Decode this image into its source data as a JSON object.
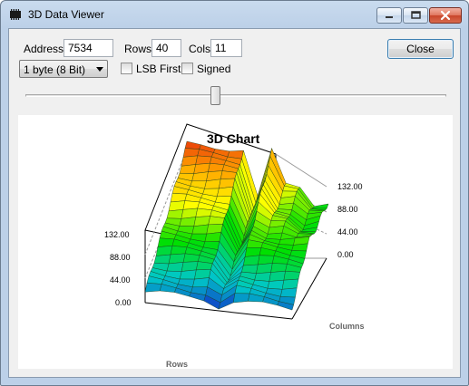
{
  "window": {
    "title": "3D Data Viewer"
  },
  "controls": {
    "address_label": "Address",
    "address_value": "7534",
    "rows_label": "Rows",
    "rows_value": "40",
    "cols_label": "Cols",
    "cols_value": "11",
    "close_label": "Close",
    "datatype_value": "1 byte (8 Bit)",
    "lsb_first_label": "LSB First",
    "lsb_first_checked": false,
    "signed_label": "Signed",
    "signed_checked": false,
    "slider_fraction": 0.45
  },
  "chart_data": {
    "type": "surface",
    "title": "3D Chart",
    "xlabel": "Columns",
    "ylabel": "Rows",
    "left_axis_ticks": [
      "0.00",
      "44.00",
      "88.00",
      "132.00"
    ],
    "right_axis_ticks": [
      "0.00",
      "44.00",
      "88.00",
      "132.00"
    ],
    "zlim": [
      0,
      176
    ],
    "colormap": [
      "#1414c8",
      "#00c8c8",
      "#00e000",
      "#ffff00",
      "#ffa000",
      "#e01010"
    ]
  }
}
